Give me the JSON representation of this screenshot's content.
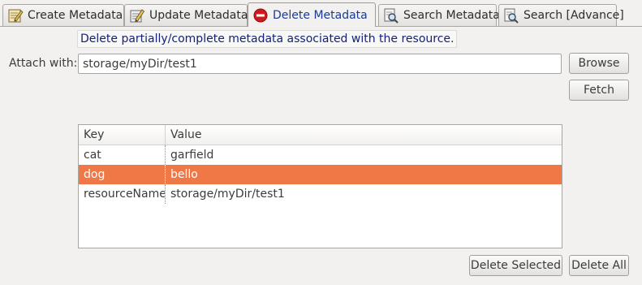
{
  "tabs": [
    {
      "label": "Create Metadata",
      "icon": "create-metadata-icon",
      "active": false
    },
    {
      "label": "Update Metadata",
      "icon": "update-metadata-icon",
      "active": false
    },
    {
      "label": "Delete Metadata",
      "icon": "delete-metadata-icon",
      "active": true
    },
    {
      "label": "Search Metadata",
      "icon": "search-metadata-icon",
      "active": false
    },
    {
      "label": "Search [Advance]",
      "icon": "search-advance-icon",
      "active": false
    }
  ],
  "description": "Delete partially/complete metadata associated with the resource.",
  "attach": {
    "label": "Attach with:",
    "value": "storage/myDir/test1"
  },
  "buttons": {
    "browse": "Browse",
    "fetch": "Fetch",
    "delete_selected": "Delete Selected",
    "delete_all": "Delete All"
  },
  "table": {
    "columns": [
      "Key",
      "Value"
    ],
    "rows": [
      {
        "key": "cat",
        "value": "garfield",
        "selected": false
      },
      {
        "key": "dog",
        "value": "bello",
        "selected": true
      },
      {
        "key": "resourceName",
        "value": "storage/myDir/test1",
        "selected": false
      }
    ]
  },
  "colors": {
    "selection": "#f07746",
    "description_text": "#14207a",
    "delete_icon": "#d21a1a"
  }
}
